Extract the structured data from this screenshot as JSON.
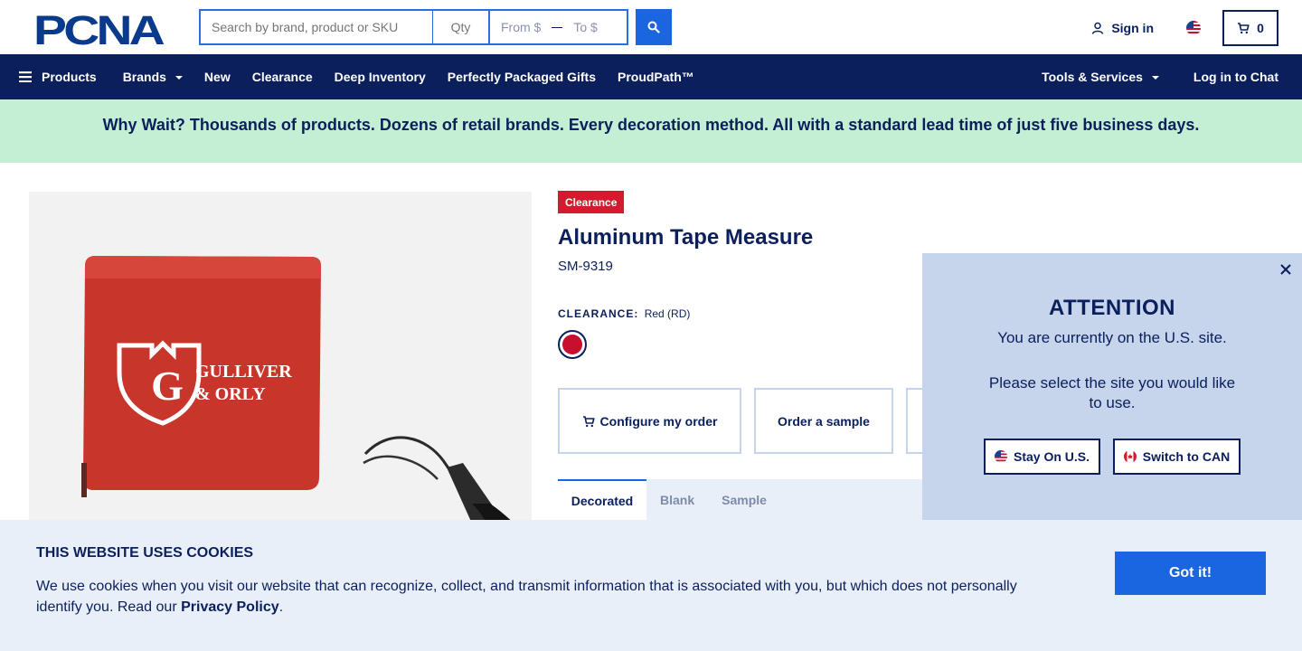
{
  "brand": {
    "logo_text": "PCNA",
    "colors": {
      "navy": "#0a1f5c",
      "blue": "#1a66e0",
      "red": "#d41a2e",
      "mint": "#c4efd4"
    }
  },
  "header": {
    "search_placeholder": "Search by brand, product or SKU",
    "qty_placeholder": "Qty",
    "from_placeholder": "From $",
    "to_placeholder": "To $",
    "search_icon": "search-icon",
    "signin_label": "Sign in",
    "cart_count": "0"
  },
  "nav": {
    "products": "Products",
    "brands": "Brands",
    "new": "New",
    "clearance": "Clearance",
    "deep_inventory": "Deep Inventory",
    "gifts": "Perfectly Packaged Gifts",
    "proudpath": "ProudPath™",
    "tools": "Tools & Services",
    "chat": "Log in to Chat"
  },
  "promo": {
    "text": "Why Wait? Thousands of products. Dozens of retail brands. Every decoration method. All with a standard lead time of just five business days."
  },
  "product": {
    "badge": "Clearance",
    "title": "Aluminum Tape Measure",
    "sku": "SM-9319",
    "clearance_label": "CLEARANCE:",
    "color_name": "Red (RD)",
    "swatch_color": "#c8102e",
    "image_brand_line1": "GULLIVER",
    "image_brand_line2": "& ORLY",
    "configure_label": "Configure my order",
    "sample_label": "Order a sample",
    "tabs": [
      "Decorated",
      "Blank",
      "Sample"
    ]
  },
  "site_modal": {
    "title": "ATTENTION",
    "line1": "You are currently on the U.S. site.",
    "line2": "Please select the site you would like to use.",
    "stay_label": "Stay On U.S.",
    "switch_label": "Switch to CAN"
  },
  "cookie": {
    "title": "THIS WEBSITE USES COOKIES",
    "text": "We use cookies when you visit our website that can recognize, collect, and transmit information that is associated with you, but which does not personally identify you. Read our",
    "link": "Privacy Policy",
    "period": ".",
    "button": "Got it!"
  }
}
